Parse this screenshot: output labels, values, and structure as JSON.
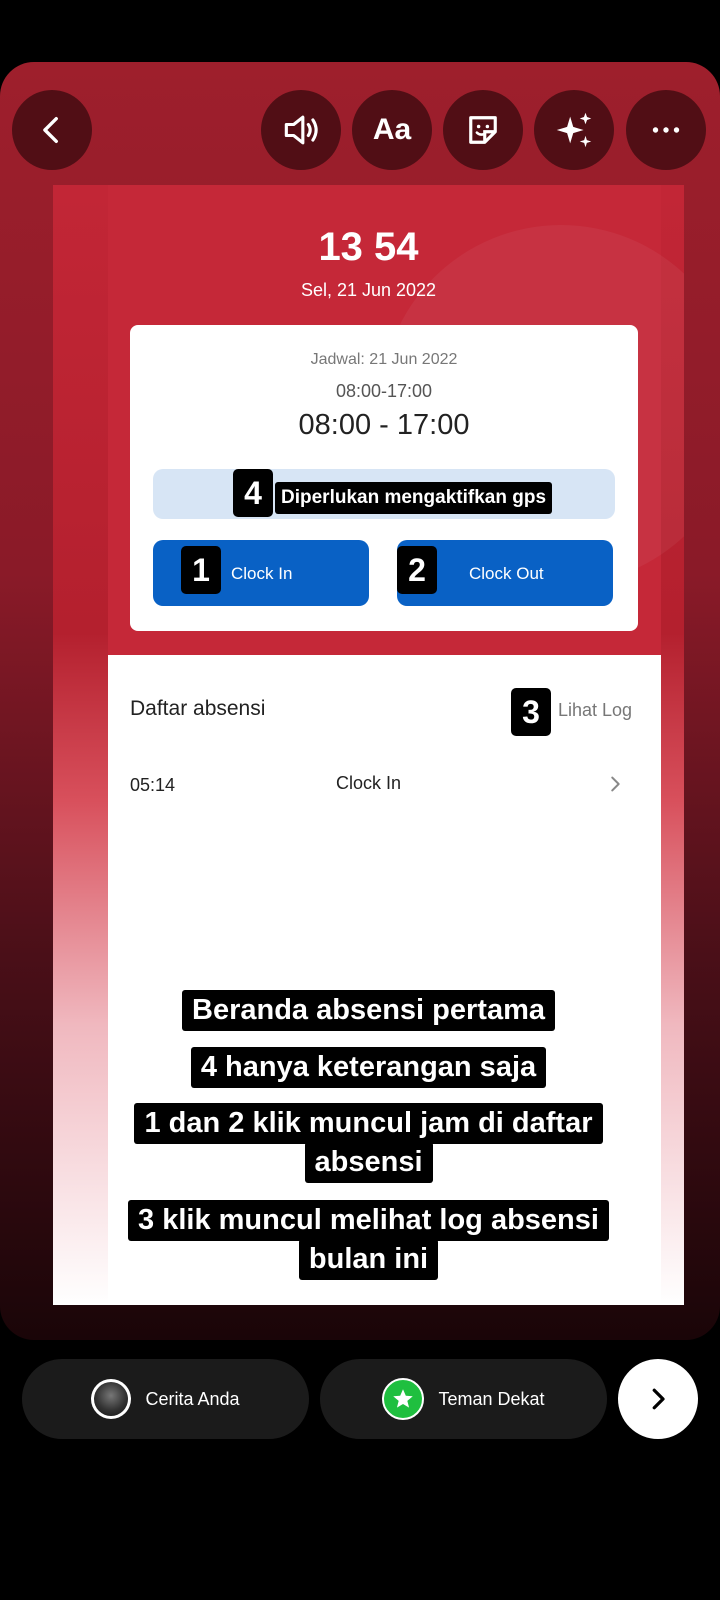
{
  "toolbar": {
    "back_icon": "chevron-left-icon",
    "sound_icon": "speaker-icon",
    "text_label": "Aa",
    "sticker_icon": "sticker-icon",
    "effects_icon": "sparkles-icon",
    "more_icon": "more-horizontal-icon"
  },
  "app": {
    "time": "13 54",
    "date": "Sel, 21 Jun 2022",
    "schedule_label": "Jadwal: 21 Jun 2022",
    "schedule_small": "08:00-17:00",
    "schedule_big": "08:00 - 17:00",
    "gps_badge": "4",
    "gps_text": "Diperlukan mengaktifkan gps",
    "clock_in_badge": "1",
    "clock_in_label": "Clock In",
    "clock_out_badge": "2",
    "clock_out_label": "Clock Out",
    "list_title": "Daftar absensi",
    "log_badge": "3",
    "log_link": "Lihat Log",
    "rows": [
      {
        "time": "05:14",
        "type": "Clock In"
      }
    ]
  },
  "captions": {
    "line1": "Beranda absensi pertama",
    "line2": "4 hanya keterangan saja",
    "line3a": "1 dan 2 klik muncul jam di daftar",
    "line3b": "absensi",
    "line4a": "3 klik muncul melihat log absensi",
    "line4b": "bulan ini"
  },
  "bottom": {
    "your_story": "Cerita Anda",
    "close_friends": "Teman Dekat",
    "next_icon": "chevron-right-icon"
  },
  "colors": {
    "accent_red": "#c52838",
    "button_blue": "#0961c5",
    "close_friends_green": "#1fbf3f"
  }
}
